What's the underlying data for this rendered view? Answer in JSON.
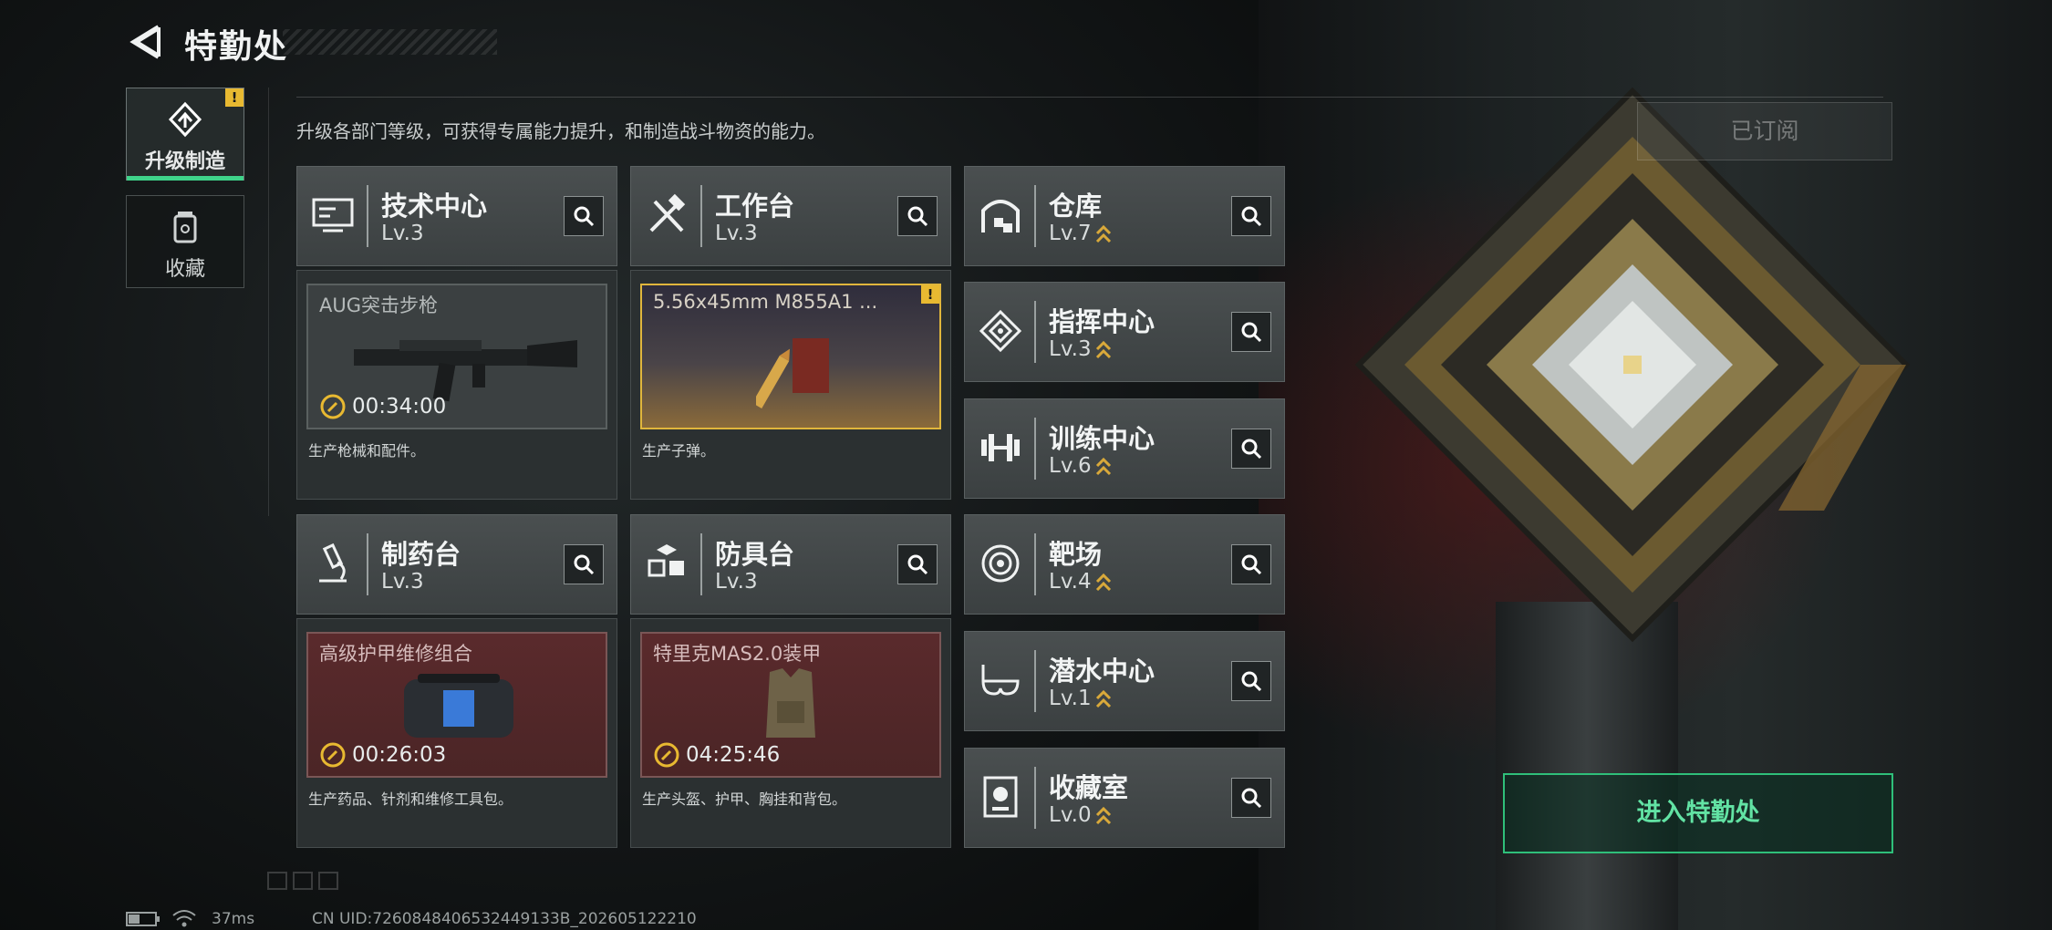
{
  "header": {
    "title": "特勤处"
  },
  "subtitle": "升级各部门等级，可获得专属能力提升，和制造战斗物资的能力。",
  "nav": {
    "items": [
      {
        "label": "升级制造",
        "active": true,
        "alert": "!"
      },
      {
        "label": "收藏",
        "active": false
      }
    ]
  },
  "cards_large": [
    {
      "name": "技术中心",
      "level": "Lv.3",
      "icon": "monitor-icon",
      "slot": {
        "name": "AUG突击步枪",
        "timer": "00:34:00",
        "style": "grey"
      },
      "desc": "生产枪械和配件。"
    },
    {
      "name": "工作台",
      "level": "Lv.3",
      "icon": "hammer-wrench-icon",
      "slot": {
        "name": "5.56x45mm M855A1 ...",
        "timer": "",
        "style": "gold",
        "alert": "!"
      },
      "desc": "生产子弹。"
    },
    {
      "name": "制药台",
      "level": "Lv.3",
      "icon": "microscope-icon",
      "slot": {
        "name": "高级护甲维修组合",
        "timer": "00:26:03",
        "style": "red"
      },
      "desc": "生产药品、针剂和维修工具包。"
    },
    {
      "name": "防具台",
      "level": "Lv.3",
      "icon": "cubes-icon",
      "slot": {
        "name": "特里克MAS2.0装甲",
        "timer": "04:25:46",
        "style": "red"
      },
      "desc": "生产头盔、护甲、胸挂和背包。"
    }
  ],
  "cards_small": [
    {
      "name": "仓库",
      "level": "Lv.7",
      "icon": "warehouse-icon"
    },
    {
      "name": "指挥中心",
      "level": "Lv.3",
      "icon": "command-icon"
    },
    {
      "name": "训练中心",
      "level": "Lv.6",
      "icon": "dumbbell-icon"
    },
    {
      "name": "靶场",
      "level": "Lv.4",
      "icon": "target-icon"
    },
    {
      "name": "潜水中心",
      "level": "Lv.1",
      "icon": "diving-mask-icon"
    },
    {
      "name": "收藏室",
      "level": "Lv.0",
      "icon": "trophy-icon"
    }
  ],
  "buttons": {
    "enter": "进入特勤处",
    "subscribed": "已订阅"
  },
  "status": {
    "ping": "37ms",
    "uid": "CN UID:7260848406532449133B_202605122210"
  },
  "colors": {
    "accent_green": "#3fd38a",
    "alert_gold": "#e8b931",
    "level_up_gold": "#d9a93a"
  }
}
